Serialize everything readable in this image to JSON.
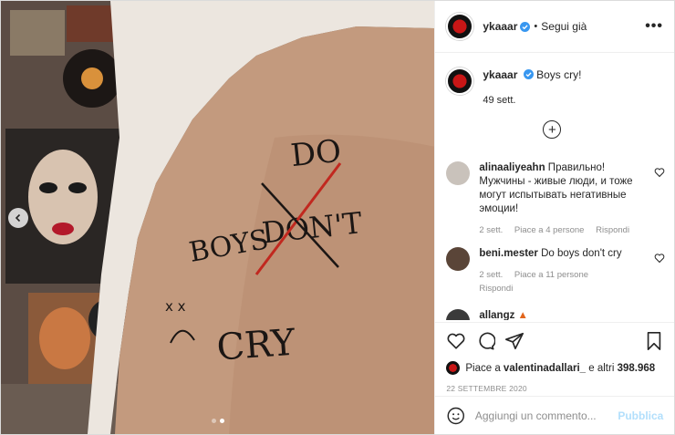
{
  "header": {
    "username": "ykaaar",
    "follow_label": "Segui già",
    "separator": "•",
    "more_icon": "more-dots-icon"
  },
  "caption": {
    "username": "ykaaar",
    "text": "Boys cry!",
    "time": "49 sett."
  },
  "comments": [
    {
      "username": "alinaaliyeahn",
      "text": "Правильно! Мужчины - живые люди, и тоже могут испытывать негативные эмоции!",
      "time": "2 sett.",
      "likes": "Piace a 4 persone",
      "reply": "Rispondi"
    },
    {
      "username": "beni.mester",
      "text": "Do boys don't cry",
      "time": "2 sett.",
      "likes": "Piace a 11 persone",
      "reply": "Rispondi"
    },
    {
      "username": "allangz",
      "text": ""
    }
  ],
  "likes": {
    "prefix": "Piace a",
    "user": "valentinadallari_",
    "suffix": "e altri",
    "count": "398.968"
  },
  "date": "22 SETTEMBRE 2020",
  "composer": {
    "placeholder": "Aggiungi un commento...",
    "publish_label": "Pubblica"
  },
  "photo": {
    "tattoo_do": "DO",
    "tattoo_boys": "BOYS",
    "tattoo_dont": "DON'T",
    "tattoo_cry": "CRY",
    "tattoo_face": "x x"
  },
  "carousel": {
    "total": 2,
    "active": 2
  },
  "colors": {
    "verified": "#3897f0",
    "publish_disabled": "#b2dffc",
    "meta_text": "#8e8e8e"
  }
}
